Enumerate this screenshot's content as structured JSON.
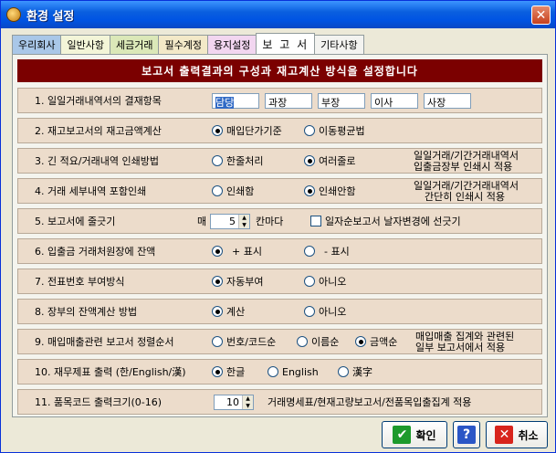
{
  "window": {
    "title": "환경 설정"
  },
  "tabs": [
    {
      "label": "우리회사",
      "color": "#a9c7e8"
    },
    {
      "label": "일반사항",
      "color": "#f3f5d8"
    },
    {
      "label": "세금거래",
      "color": "#dbe8b8"
    },
    {
      "label": "필수계정",
      "color": "#f3e9c8"
    },
    {
      "label": "용지설정",
      "color": "#f2d6f0"
    },
    {
      "label": "보 고 서",
      "color": "#ffffff"
    },
    {
      "label": "기타사항",
      "color": "#f3f3f0"
    }
  ],
  "banner": "보고서 출력결과의 구성과 재고계산 방식을 설정합니다",
  "rows": {
    "r1": {
      "label": "1. 일일거래내역서의 결재항목",
      "fields": [
        "담당",
        "과장",
        "부장",
        "이사",
        "사장"
      ]
    },
    "r2": {
      "label": "2. 재고보고서의 재고금액계산",
      "opt1": "매입단가기준",
      "opt2": "이동평균법"
    },
    "r3": {
      "label": "3. 긴 적요/거래내역 인쇄방법",
      "opt1": "한줄처리",
      "opt2": "여러줄로",
      "note1": "일일거래/기간거래내역서",
      "note2": "입출금장부 인쇄시 적용"
    },
    "r4": {
      "label": "4. 거래 세부내역 포함인쇄",
      "opt1": "인쇄함",
      "opt2": "인쇄안함",
      "note1": "일일거래/기간거래내역서",
      "note2": "간단히 인쇄시 적용"
    },
    "r5": {
      "label": "5. 보고서에 줄긋기",
      "prefix": "매",
      "value": "5",
      "suffix": "칸마다",
      "check": "일자순보고서 날자변경에 선긋기"
    },
    "r6": {
      "label": "6. 입출금 거래처원장에 잔액",
      "opt1": "+ 표시",
      "opt2": "- 표시"
    },
    "r7": {
      "label": "7. 전표번호 부여방식",
      "opt1": "자동부여",
      "opt2": "아니오"
    },
    "r8": {
      "label": "8. 장부의 잔액계산 방법",
      "opt1": "계산",
      "opt2": "아니오"
    },
    "r9": {
      "label": "9. 매입매출관련 보고서 정렬순서",
      "opt1": "번호/코드순",
      "opt2": "이름순",
      "opt3": "금액순",
      "note1": "매입매출 집계와 관련된",
      "note2": "일부 보고서에서 적용"
    },
    "r10": {
      "label": "10. 재무제표 출력 (한/English/漢)",
      "opt1": "한글",
      "opt2": "English",
      "opt3": "漢字"
    },
    "r11": {
      "label": "11. 품목코드 출력크기(0-16)",
      "value": "10",
      "note": "거래명세표/현재고량보고서/전품목입출집계 적용"
    }
  },
  "buttons": {
    "ok": "확인",
    "help": "?",
    "cancel": "취소"
  },
  "icons": {
    "ok": "check-icon",
    "help": "help-icon",
    "cancel": "x-icon"
  }
}
